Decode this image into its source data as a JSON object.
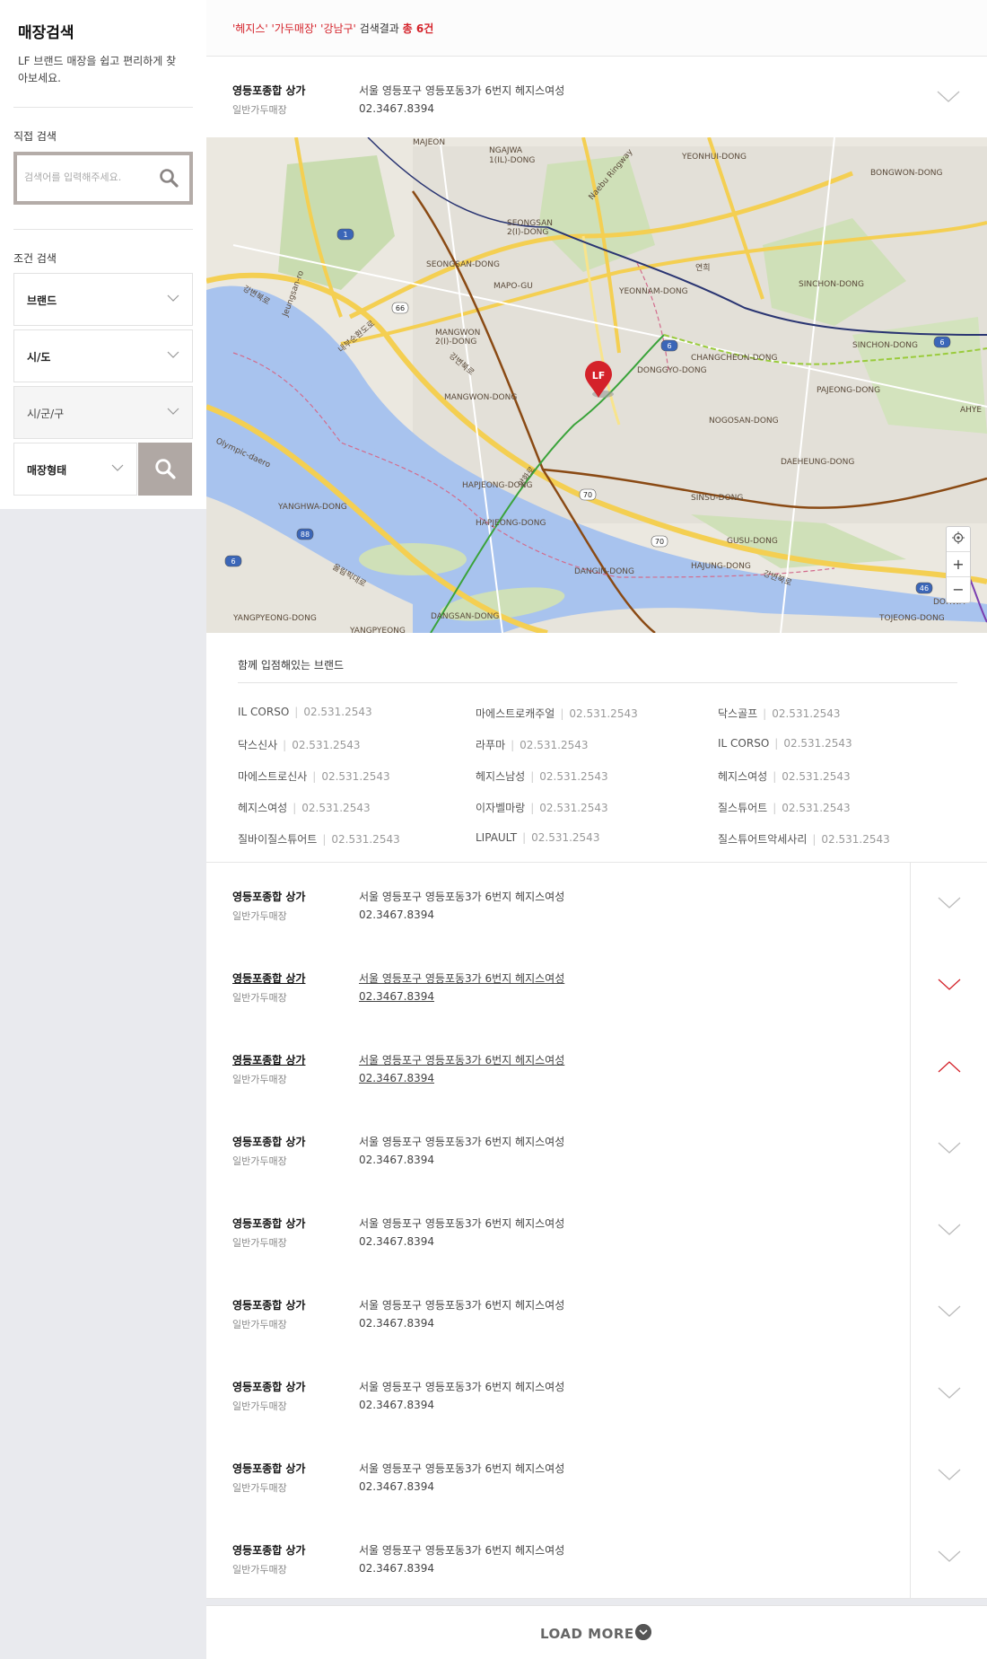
{
  "sidebar": {
    "title": "매장검색",
    "desc": "LF 브랜드 매장을 쉽고 편리하게 찾아보세요.",
    "direct_label": "직접 검색",
    "search_placeholder": "검색어를 입력해주세요.",
    "cond_label": "조건 검색",
    "brand_select": "브랜드",
    "sido_select": "시/도",
    "sigungu_select": "시/군/구",
    "type_select": "매장형태"
  },
  "results": {
    "q1": "'헤지스'",
    "q2": "'가두매장'",
    "q3": "'강남구'",
    "mid": " 검색결과 ",
    "total": "총 6건"
  },
  "store": {
    "name": "영등포종합 상가",
    "type": "일반가두매장",
    "addr": "서울 영등포구 영등포동3가 6번지 헤지스여성",
    "phone": "02.3467.8394"
  },
  "brands_title": "함께 입점해있는 브랜드",
  "brands": [
    {
      "name": "IL CORSO",
      "phone": "02.531.2543"
    },
    {
      "name": "마에스트로캐주얼",
      "phone": "02.531.2543"
    },
    {
      "name": "닥스골프",
      "phone": "02.531.2543"
    },
    {
      "name": "닥스신사",
      "phone": "02.531.2543"
    },
    {
      "name": "라푸마",
      "phone": "02.531.2543"
    },
    {
      "name": "IL CORSO",
      "phone": "02.531.2543"
    },
    {
      "name": "마에스트로신사",
      "phone": "02.531.2543"
    },
    {
      "name": "헤지스남성",
      "phone": "02.531.2543"
    },
    {
      "name": "헤지스여성",
      "phone": "02.531.2543"
    },
    {
      "name": "헤지스여성",
      "phone": "02.531.2543"
    },
    {
      "name": "이자벨마랑",
      "phone": "02.531.2543"
    },
    {
      "name": "질스튜어트",
      "phone": "02.531.2543"
    },
    {
      "name": "질바이질스튜어트",
      "phone": "02.531.2543"
    },
    {
      "name": "LIPAULT",
      "phone": "02.531.2543"
    },
    {
      "name": "질스튜어트악세사리",
      "phone": "02.531.2543"
    }
  ],
  "map": {
    "marker_label": "LF",
    "labels": [
      "MAJEON",
      "NGAJWA",
      "1(IL)-DONG",
      "YEONHUI-DONG",
      "BONGWON-DONG",
      "SEONGSAN",
      "2(I)-DONG",
      "SEONGSAN-DONG",
      "MAPO-GU",
      "YEONNAM-DONG",
      "SINCHON-DONG",
      "SINCHON-DONG",
      "MANGWON",
      "2(I)-DONG",
      "MANGWON-DONG",
      "DONGGYO-DONG",
      "CHANGCHEON-DONG",
      "NOGOSAN-DONG",
      "DAEHEUNG-DONG",
      "HAPJEONG-DONG",
      "HAPJEONG-DONG",
      "YANGHWA-DONG",
      "SINSU-DONG",
      "GUSU-DONG",
      "DANGIN-DONG",
      "HAJUNG-DONG",
      "YANGPYEONG-DONG",
      "DANGSAN-DONG",
      "TOJEONG-DONG",
      "DOHWA-",
      "AHYE",
      "YANGPYEONG",
      "PAJEONG-DONG",
      "Jeungsan-ro",
      "강변북로",
      "내부순환도로",
      "양화로",
      "Olympic-daero",
      "올림픽대로",
      "강변북로",
      "강변북로",
      "Naebu Ringway",
      "연희"
    ],
    "routes": [
      "1",
      "66",
      "6",
      "6",
      "70",
      "70",
      "88",
      "6",
      "46"
    ]
  },
  "load_more": "LOAD MORE"
}
